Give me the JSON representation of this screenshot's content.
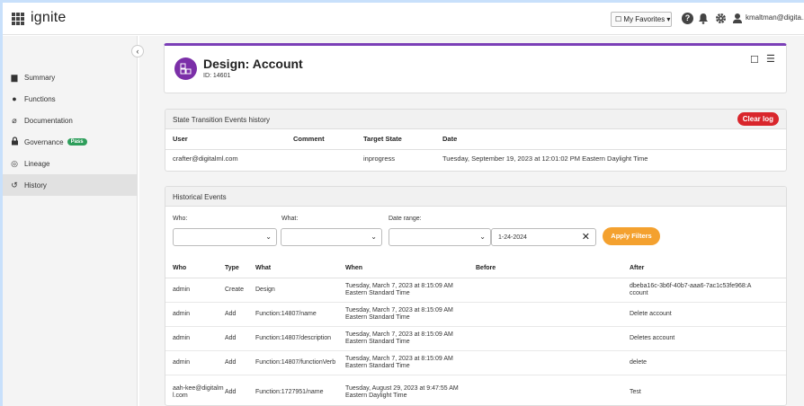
{
  "header": {
    "brand": "ignite",
    "favorites_label": "My Favorites ▾",
    "username": "kmaltman@digita..."
  },
  "sidebar": {
    "items": [
      {
        "label": "Summary",
        "icon": "document-icon"
      },
      {
        "label": "Functions",
        "icon": "circle-icon"
      },
      {
        "label": "Documentation",
        "icon": "paperclip-icon"
      },
      {
        "label": "Governance",
        "icon": "lock-icon",
        "badge": "Pass"
      },
      {
        "label": "Lineage",
        "icon": "lineage-icon"
      },
      {
        "label": "History",
        "icon": "history-icon",
        "active": true
      }
    ]
  },
  "design": {
    "title": "Design: Account",
    "id": "ID: 14601"
  },
  "state_history": {
    "title": "State Transition Events history",
    "clear_label": "Clear log",
    "columns": [
      "User",
      "Comment",
      "Target State",
      "Date"
    ],
    "rows": [
      {
        "user": "crafter@digitalml.com",
        "comment": "",
        "target_state": "inprogress",
        "date": "Tuesday, September 19, 2023 at 12:01:02 PM Eastern Daylight Time"
      }
    ]
  },
  "historical": {
    "title": "Historical Events",
    "filters": {
      "who_label": "Who:",
      "what_label": "What:",
      "date_label": "Date range:",
      "date_value": "1-24-2024",
      "apply_label": "Apply Filters"
    },
    "columns": [
      "Who",
      "Type",
      "What",
      "When",
      "Before",
      "After"
    ],
    "rows": [
      {
        "who": "admin",
        "type": "Create",
        "what": "Design",
        "when": "Tuesday, March 7, 2023 at 8:15:09 AM Eastern Standard Time",
        "before": "",
        "after": "dbeba16c-3b6f-40b7-aaa6-7ac1c53fe968:Account"
      },
      {
        "who": "admin",
        "type": "Add",
        "what": "Function:14807/name",
        "when": "Tuesday, March 7, 2023 at 8:15:09 AM Eastern Standard Time",
        "before": "",
        "after": "Delete account"
      },
      {
        "who": "admin",
        "type": "Add",
        "what": "Function:14807/description",
        "when": "Tuesday, March 7, 2023 at 8:15:09 AM Eastern Standard Time",
        "before": "",
        "after": "Deletes account"
      },
      {
        "who": "admin",
        "type": "Add",
        "what": "Function:14807/functionVerb",
        "when": "Tuesday, March 7, 2023 at 8:15:09 AM Eastern Standard Time",
        "before": "",
        "after": "delete"
      },
      {
        "who": "aah-kee@digitalml.com",
        "type": "Add",
        "what": "Function:1727951/name",
        "when": "Tuesday, August 29, 2023 at 9:47:55 AM Eastern Daylight Time",
        "before": "",
        "after": "Test"
      }
    ]
  },
  "colors": {
    "accent_purple": "#7b2fa8",
    "clear_red": "#d9262c",
    "apply_orange": "#f4a12f",
    "pass_green": "#2e9e5b"
  }
}
